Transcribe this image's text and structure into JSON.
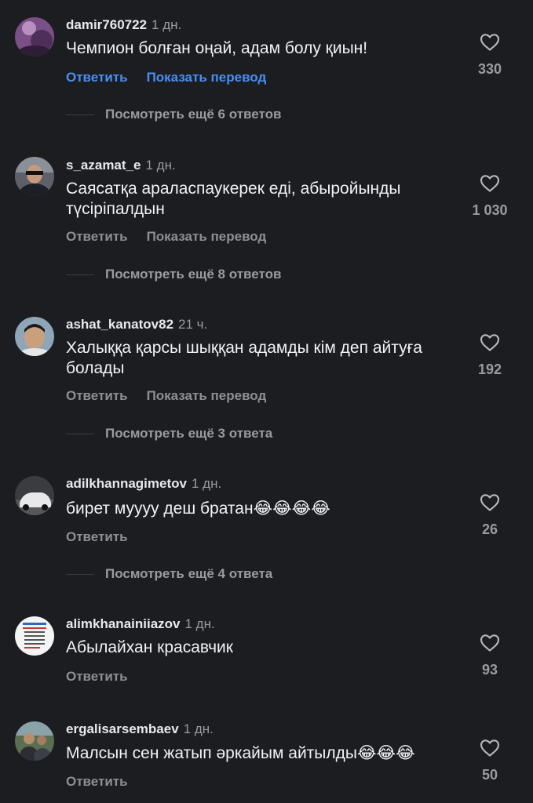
{
  "comments": [
    {
      "username": "damir760722",
      "time": "1 дн.",
      "text": "Чемпион болған оңай, адам болу қиын!",
      "reply": "Ответить",
      "translate": "Показать перевод",
      "likes": "330",
      "more": "Посмотреть ещё 6 ответов"
    },
    {
      "username": "s_azamat_e",
      "time": "1 дн.",
      "text": "Саясатқа араласпаукерек еді, абыройынды түсіріпалдын",
      "reply": "Ответить",
      "translate": "Показать перевод",
      "likes": "1 030",
      "more": "Посмотреть ещё 8 ответов"
    },
    {
      "username": "ashat_kanatov82",
      "time": "21 ч.",
      "text": "Халыққа қарсы шыққан адамды кім деп айтуға болады",
      "reply": "Ответить",
      "translate": "Показать перевод",
      "likes": "192",
      "more": "Посмотреть ещё 3 ответа"
    },
    {
      "username": "adilkhannagimetov",
      "time": "1 дн.",
      "text": "бирет муууу деш братан",
      "emoji": "😂😂😂😂",
      "reply": "Ответить",
      "likes": "26",
      "more": "Посмотреть ещё 4 ответа"
    },
    {
      "username": "alimkhanainiiazov",
      "time": "1 дн.",
      "text": "Абылайхан красавчик",
      "reply": "Ответить",
      "likes": "93"
    },
    {
      "username": "ergalisarsembaev",
      "time": "1 дн.",
      "text": "Малсын сен жатып әркайым айтылды",
      "emoji": "😂😂😂",
      "reply": "Ответить",
      "likes": "50"
    }
  ],
  "colors": {
    "background": "#1c1d21",
    "accent": "#4a8ff0",
    "muted": "#9a9ba1"
  },
  "icons": {
    "like": "heart-outline-icon"
  }
}
